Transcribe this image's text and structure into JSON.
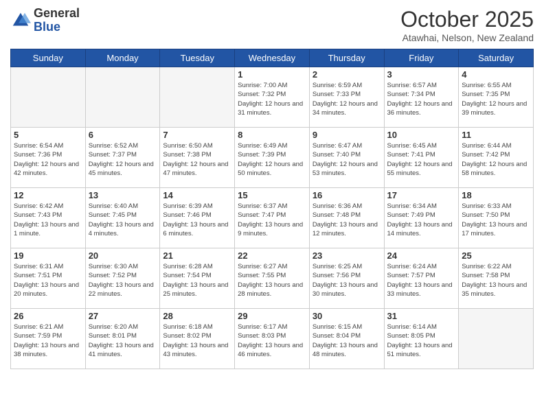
{
  "header": {
    "logo_general": "General",
    "logo_blue": "Blue",
    "month_title": "October 2025",
    "subtitle": "Atawhai, Nelson, New Zealand"
  },
  "days_of_week": [
    "Sunday",
    "Monday",
    "Tuesday",
    "Wednesday",
    "Thursday",
    "Friday",
    "Saturday"
  ],
  "weeks": [
    [
      {
        "day": "",
        "info": ""
      },
      {
        "day": "",
        "info": ""
      },
      {
        "day": "",
        "info": ""
      },
      {
        "day": "1",
        "info": "Sunrise: 7:00 AM\nSunset: 7:32 PM\nDaylight: 12 hours\nand 31 minutes."
      },
      {
        "day": "2",
        "info": "Sunrise: 6:59 AM\nSunset: 7:33 PM\nDaylight: 12 hours\nand 34 minutes."
      },
      {
        "day": "3",
        "info": "Sunrise: 6:57 AM\nSunset: 7:34 PM\nDaylight: 12 hours\nand 36 minutes."
      },
      {
        "day": "4",
        "info": "Sunrise: 6:55 AM\nSunset: 7:35 PM\nDaylight: 12 hours\nand 39 minutes."
      }
    ],
    [
      {
        "day": "5",
        "info": "Sunrise: 6:54 AM\nSunset: 7:36 PM\nDaylight: 12 hours\nand 42 minutes."
      },
      {
        "day": "6",
        "info": "Sunrise: 6:52 AM\nSunset: 7:37 PM\nDaylight: 12 hours\nand 45 minutes."
      },
      {
        "day": "7",
        "info": "Sunrise: 6:50 AM\nSunset: 7:38 PM\nDaylight: 12 hours\nand 47 minutes."
      },
      {
        "day": "8",
        "info": "Sunrise: 6:49 AM\nSunset: 7:39 PM\nDaylight: 12 hours\nand 50 minutes."
      },
      {
        "day": "9",
        "info": "Sunrise: 6:47 AM\nSunset: 7:40 PM\nDaylight: 12 hours\nand 53 minutes."
      },
      {
        "day": "10",
        "info": "Sunrise: 6:45 AM\nSunset: 7:41 PM\nDaylight: 12 hours\nand 55 minutes."
      },
      {
        "day": "11",
        "info": "Sunrise: 6:44 AM\nSunset: 7:42 PM\nDaylight: 12 hours\nand 58 minutes."
      }
    ],
    [
      {
        "day": "12",
        "info": "Sunrise: 6:42 AM\nSunset: 7:43 PM\nDaylight: 13 hours\nand 1 minute."
      },
      {
        "day": "13",
        "info": "Sunrise: 6:40 AM\nSunset: 7:45 PM\nDaylight: 13 hours\nand 4 minutes."
      },
      {
        "day": "14",
        "info": "Sunrise: 6:39 AM\nSunset: 7:46 PM\nDaylight: 13 hours\nand 6 minutes."
      },
      {
        "day": "15",
        "info": "Sunrise: 6:37 AM\nSunset: 7:47 PM\nDaylight: 13 hours\nand 9 minutes."
      },
      {
        "day": "16",
        "info": "Sunrise: 6:36 AM\nSunset: 7:48 PM\nDaylight: 13 hours\nand 12 minutes."
      },
      {
        "day": "17",
        "info": "Sunrise: 6:34 AM\nSunset: 7:49 PM\nDaylight: 13 hours\nand 14 minutes."
      },
      {
        "day": "18",
        "info": "Sunrise: 6:33 AM\nSunset: 7:50 PM\nDaylight: 13 hours\nand 17 minutes."
      }
    ],
    [
      {
        "day": "19",
        "info": "Sunrise: 6:31 AM\nSunset: 7:51 PM\nDaylight: 13 hours\nand 20 minutes."
      },
      {
        "day": "20",
        "info": "Sunrise: 6:30 AM\nSunset: 7:52 PM\nDaylight: 13 hours\nand 22 minutes."
      },
      {
        "day": "21",
        "info": "Sunrise: 6:28 AM\nSunset: 7:54 PM\nDaylight: 13 hours\nand 25 minutes."
      },
      {
        "day": "22",
        "info": "Sunrise: 6:27 AM\nSunset: 7:55 PM\nDaylight: 13 hours\nand 28 minutes."
      },
      {
        "day": "23",
        "info": "Sunrise: 6:25 AM\nSunset: 7:56 PM\nDaylight: 13 hours\nand 30 minutes."
      },
      {
        "day": "24",
        "info": "Sunrise: 6:24 AM\nSunset: 7:57 PM\nDaylight: 13 hours\nand 33 minutes."
      },
      {
        "day": "25",
        "info": "Sunrise: 6:22 AM\nSunset: 7:58 PM\nDaylight: 13 hours\nand 35 minutes."
      }
    ],
    [
      {
        "day": "26",
        "info": "Sunrise: 6:21 AM\nSunset: 7:59 PM\nDaylight: 13 hours\nand 38 minutes."
      },
      {
        "day": "27",
        "info": "Sunrise: 6:20 AM\nSunset: 8:01 PM\nDaylight: 13 hours\nand 41 minutes."
      },
      {
        "day": "28",
        "info": "Sunrise: 6:18 AM\nSunset: 8:02 PM\nDaylight: 13 hours\nand 43 minutes."
      },
      {
        "day": "29",
        "info": "Sunrise: 6:17 AM\nSunset: 8:03 PM\nDaylight: 13 hours\nand 46 minutes."
      },
      {
        "day": "30",
        "info": "Sunrise: 6:15 AM\nSunset: 8:04 PM\nDaylight: 13 hours\nand 48 minutes."
      },
      {
        "day": "31",
        "info": "Sunrise: 6:14 AM\nSunset: 8:05 PM\nDaylight: 13 hours\nand 51 minutes."
      },
      {
        "day": "",
        "info": ""
      }
    ]
  ]
}
